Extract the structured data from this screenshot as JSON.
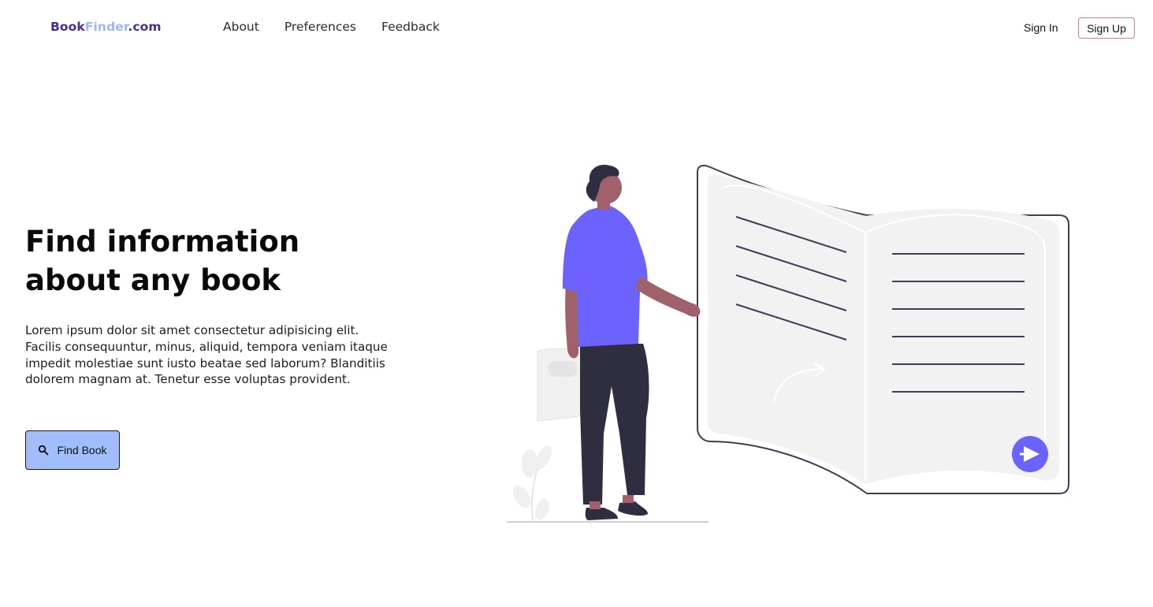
{
  "header": {
    "logo": {
      "part1": "Book",
      "part2": "Finder",
      "part3": ".com"
    },
    "nav": [
      "About",
      "Preferences",
      "Feedback"
    ],
    "sign_in": "Sign In",
    "sign_up": "Sign Up"
  },
  "hero": {
    "title_line1": "Find information",
    "title_line2": "about any book",
    "description": "Lorem ipsum dolor sit amet consectetur adipisicing elit. Facilis consequuntur, minus, aliquid, tempora veniam itaque impedit molestiae sunt iusto beatae sed laborum? Blanditiis dolorem magnam at. Tenetur esse voluptas provident.",
    "button_label": "Find Book",
    "button_icon": "search-icon"
  },
  "colors": {
    "logo_dark": "#4b2c8c",
    "logo_light": "#9db8f6",
    "button_bg": "#a2bdfb",
    "signup_border": "#e07a8f",
    "accent_purple": "#6c63ff",
    "book_page": "#f2f2f2",
    "outline_dark": "#3f3d56"
  }
}
